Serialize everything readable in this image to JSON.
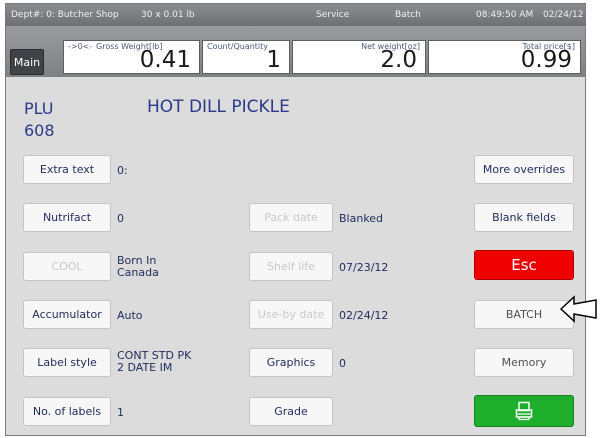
{
  "status": {
    "dept": "Dept#: 0: Butcher Shop",
    "scale": "30 x 0.01 lb",
    "mode": "Service",
    "batch": "Batch",
    "time": "08:49:50 AM",
    "date": "02/24/12"
  },
  "main_button": "Main",
  "weights": {
    "zero_indicator": "->0<-",
    "gross": {
      "caption": "Gross  Weight[lb]",
      "value": "0.41"
    },
    "count": {
      "caption": "Count/Quantity",
      "value": "1"
    },
    "net": {
      "caption": "Net weight[oz]",
      "value": "2.0"
    },
    "total": {
      "caption": "Total price[$]",
      "value": "0.99"
    }
  },
  "plu": {
    "label": "PLU",
    "number": "608",
    "name": "HOT DILL PICKLE"
  },
  "fields": {
    "extra_text": {
      "label": "Extra text",
      "value": "0:"
    },
    "nutrifact": {
      "label": "Nutrifact",
      "value": "0"
    },
    "cool": {
      "label": "COOL",
      "value_line1": "Born In",
      "value_line2": "Canada"
    },
    "accumulator": {
      "label": "Accumulator",
      "value": "Auto"
    },
    "label_style": {
      "label": "Label style",
      "value_line1": "CONT STD PK",
      "value_line2": "2 DATE IM"
    },
    "no_of_labels": {
      "label": "No. of labels",
      "value": "1"
    },
    "pack_date": {
      "label": "Pack date",
      "value": "Blanked"
    },
    "shelf_life": {
      "label": "Shelf life",
      "value": "07/23/12"
    },
    "use_by_date": {
      "label": "Use-by date",
      "value": "02/24/12"
    },
    "graphics": {
      "label": "Graphics",
      "value": "0"
    },
    "grade": {
      "label": "Grade"
    }
  },
  "right_buttons": {
    "more_overrides": "More overrides",
    "blank_fields": "Blank fields",
    "esc": "Esc",
    "batch": "BATCH",
    "memory": "Memory",
    "print_icon": "printer-icon"
  },
  "colors": {
    "esc": "#ee0000",
    "print": "#1fae2c",
    "text": "#1f2c5c",
    "plu_text": "#2b3a8a"
  }
}
